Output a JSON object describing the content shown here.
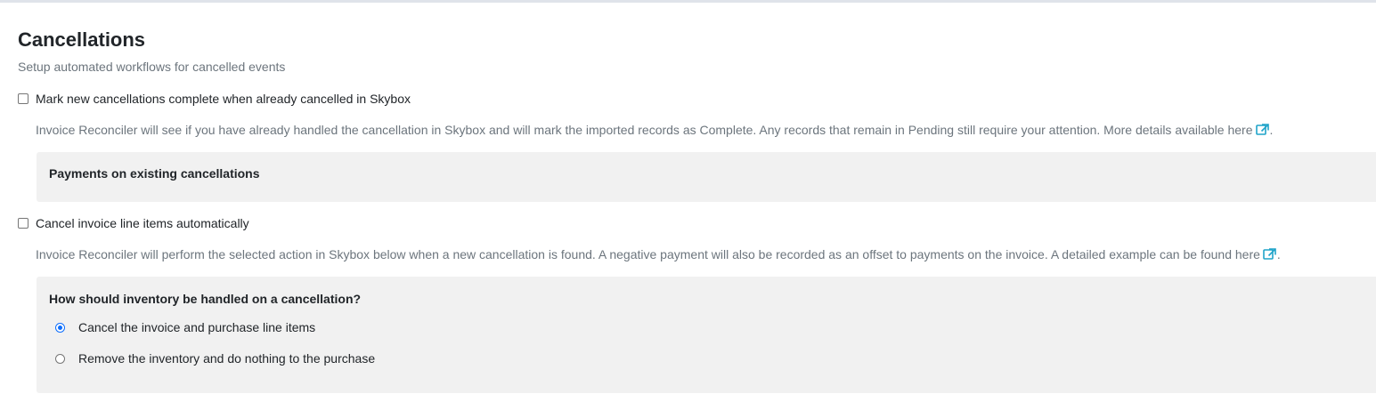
{
  "section": {
    "title": "Cancellations",
    "subtitle": "Setup automated workflows for cancelled events"
  },
  "option_mark_complete": {
    "label": "Mark new cancellations complete when already cancelled in Skybox",
    "checked": false,
    "description": "Invoice Reconciler will see if you have already handled the cancellation in Skybox and will mark the imported records as Complete. Any records that remain in Pending still require your attention. More details available here",
    "description_end": ".",
    "link_icon": "external-link-icon",
    "panel_title": "Payments on existing cancellations"
  },
  "option_cancel_line_items": {
    "label": "Cancel invoice line items automatically",
    "checked": false,
    "description": "Invoice Reconciler will perform the selected action in Skybox below when a new cancellation is found. A negative payment will also be recorded as an offset to payments on the invoice. A detailed example can be found here",
    "description_end": ".",
    "link_icon": "external-link-icon",
    "panel_title": "How should inventory be handled on a cancellation?",
    "radio_options": [
      {
        "label": "Cancel the invoice and purchase line items",
        "selected": true
      },
      {
        "label": "Remove the inventory and do nothing to the purchase",
        "selected": false
      }
    ]
  },
  "colors": {
    "link_accent": "#1fa3c9",
    "radio_accent": "#0d6efd",
    "panel_background": "#f1f1f1"
  }
}
